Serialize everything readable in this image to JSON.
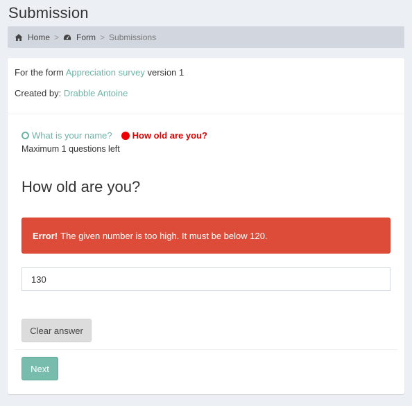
{
  "page": {
    "title": "Submission"
  },
  "breadcrumb": {
    "items": [
      {
        "label": "Home",
        "icon": "home-icon"
      },
      {
        "label": "Form",
        "icon": "dashboard-icon"
      },
      {
        "label": "Submissions"
      }
    ],
    "separator": ">"
  },
  "info": {
    "form_prefix": "For the form",
    "form_name": "Appreciation survey",
    "form_suffix": "version 1",
    "created_by_label": "Created by:",
    "creator": "Drabble Antoine"
  },
  "progress": {
    "steps": [
      {
        "label": "What is your name?",
        "status": "done"
      },
      {
        "label": "How old are you?",
        "status": "current"
      }
    ],
    "remaining": "Maximum 1 questions left"
  },
  "question": {
    "title": "How old are you?",
    "error_label": "Error!",
    "error_message": "The given number is too high. It must be below 120.",
    "answer_value": "130"
  },
  "buttons": {
    "clear": "Clear answer",
    "next": "Next"
  },
  "colors": {
    "accent": "#6fb3a5",
    "error": "#dd4b39",
    "current_step": "#ee0000",
    "next_button": "#78bcad"
  }
}
